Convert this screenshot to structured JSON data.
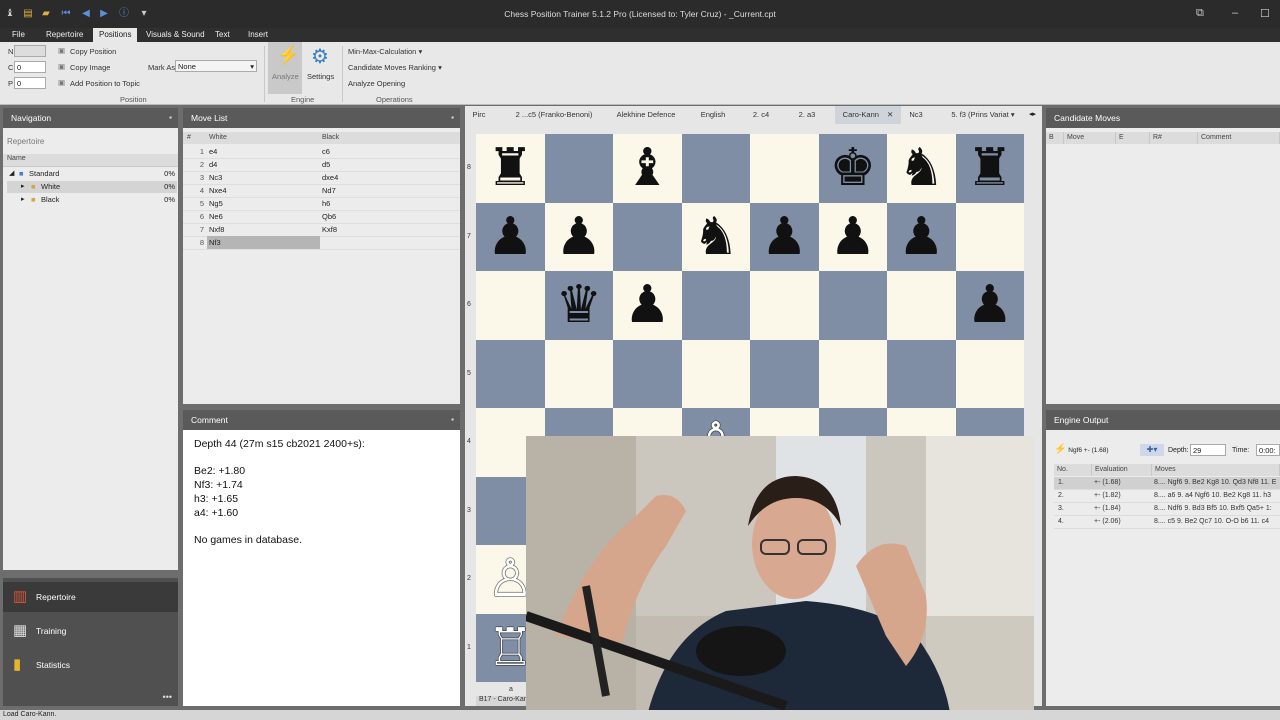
{
  "window": {
    "title": "Chess Position Trainer 5.1.2 Pro (Licensed to: Tyler Cruz) - _Current.cpt"
  },
  "ribbon_tabs": [
    {
      "label": "File",
      "active": false
    },
    {
      "label": "Repertoire",
      "active": false
    },
    {
      "label": "Positions",
      "active": true
    },
    {
      "label": "Visuals & Sound",
      "active": false
    },
    {
      "label": "Text",
      "active": false
    },
    {
      "label": "Insert",
      "active": false
    }
  ],
  "ribbon": {
    "n_label": "N",
    "c_label": "C",
    "p_label": "P",
    "c_value": "0",
    "p_value": "0",
    "copy_position": "Copy Position",
    "copy_image": "Copy Image",
    "add_position": "Add Position to Topic",
    "mark_as_label": "Mark As",
    "mark_as_value": "None",
    "position_group": "Position",
    "analyze": "Analyze",
    "settings": "Settings",
    "engine_group": "Engine",
    "min_max": "Min-Max-Calculation",
    "candidate_ranking": "Candidate Moves Ranking",
    "analyze_opening": "Analyze Opening",
    "operations_group": "Operations"
  },
  "navigation": {
    "title": "Navigation",
    "subtitle": "Repertoire",
    "col_name": "Name",
    "rows": [
      {
        "label": "Standard",
        "pct": "0%"
      },
      {
        "label": "White",
        "pct": "0%"
      },
      {
        "label": "Black",
        "pct": "0%"
      }
    ],
    "buttons": [
      {
        "label": "Repertoire"
      },
      {
        "label": "Training"
      },
      {
        "label": "Statistics"
      }
    ]
  },
  "movelist": {
    "title": "Move List",
    "headers": [
      "#",
      "White",
      "Black"
    ],
    "rows": [
      {
        "n": "1",
        "w": "e4",
        "b": "c6"
      },
      {
        "n": "2",
        "w": "d4",
        "b": "d5"
      },
      {
        "n": "3",
        "w": "Nc3",
        "b": "dxe4"
      },
      {
        "n": "4",
        "w": "Nxe4",
        "b": "Nd7"
      },
      {
        "n": "5",
        "w": "Ng5",
        "b": "h6"
      },
      {
        "n": "6",
        "w": "Ne6",
        "b": "Qb6"
      },
      {
        "n": "7",
        "w": "Nxf8",
        "b": "Kxf8"
      },
      {
        "n": "8",
        "w": "Nf3",
        "b": ""
      }
    ]
  },
  "comment": {
    "title": "Comment",
    "lines": [
      "Depth 44 (27m s15 cb2021 2400+s):",
      "Be2: +1.80",
      "Nf3: +1.74",
      "h3: +1.65",
      "a4: +1.60",
      "No games in database."
    ]
  },
  "board_tabs": [
    {
      "label": "Pirc"
    },
    {
      "label": "2 ...c5 (Franko-Benoni)"
    },
    {
      "label": "Alekhine Defence"
    },
    {
      "label": "English"
    },
    {
      "label": "2. c4"
    },
    {
      "label": "2. a3"
    },
    {
      "label": "Caro-Kann"
    },
    {
      "label": "Nc3"
    },
    {
      "label": "5. f3 (Prins Variat"
    }
  ],
  "board": {
    "ranks": [
      "8",
      "7",
      "6",
      "5",
      "4",
      "3",
      "2",
      "1"
    ],
    "file_label": "a",
    "pieces": [
      {
        "sq": "a8",
        "p": "♜",
        "c": "black"
      },
      {
        "sq": "c8",
        "p": "♝",
        "c": "black"
      },
      {
        "sq": "f8",
        "p": "♚",
        "c": "black"
      },
      {
        "sq": "g8",
        "p": "♞",
        "c": "black"
      },
      {
        "sq": "h8",
        "p": "♜",
        "c": "black"
      },
      {
        "sq": "a7",
        "p": "♟",
        "c": "black"
      },
      {
        "sq": "b7",
        "p": "♟",
        "c": "black"
      },
      {
        "sq": "d7",
        "p": "♞",
        "c": "black"
      },
      {
        "sq": "e7",
        "p": "♟",
        "c": "black"
      },
      {
        "sq": "f7",
        "p": "♟",
        "c": "black"
      },
      {
        "sq": "g7",
        "p": "♟",
        "c": "black"
      },
      {
        "sq": "b6",
        "p": "♛",
        "c": "black"
      },
      {
        "sq": "c6",
        "p": "♟",
        "c": "black"
      },
      {
        "sq": "h6",
        "p": "♟",
        "c": "black"
      },
      {
        "sq": "d4",
        "p": "♙",
        "c": "white"
      },
      {
        "sq": "a2",
        "p": "♙",
        "c": "white"
      },
      {
        "sq": "a1",
        "p": "♖",
        "c": "white"
      }
    ],
    "footer_tab": "B17 - Caro-Kann"
  },
  "candidate": {
    "title": "Candidate Moves",
    "headers": [
      "B",
      "Move",
      "E",
      "R#",
      "Comment"
    ]
  },
  "engine": {
    "title": "Engine Output",
    "toolbar_eval": "Ngf6 +- (1.68)",
    "depth_label": "Depth:",
    "depth_value": "29",
    "time_label": "Time:",
    "time_value": "0:00:",
    "headers": [
      "No.",
      "Evaluation",
      "Moves"
    ],
    "rows": [
      {
        "no": "1.",
        "eval": "+- (1.68)",
        "moves": "8.... Ngf6 9. Be2 Kg8 10. Qd3 Nf8 11. E"
      },
      {
        "no": "2.",
        "eval": "+- (1.82)",
        "moves": "8.... a6 9. a4 Ngf6 10. Be2 Kg8 11. h3"
      },
      {
        "no": "3.",
        "eval": "+- (1.84)",
        "moves": "8.... Ndf6 9. Bd3 Bf5 10. Bxf5 Qa5+ 1:"
      },
      {
        "no": "4.",
        "eval": "+- (2.06)",
        "moves": "8.... c5 9. Be2 Qc7 10. O-O b6 11. c4"
      }
    ]
  },
  "status": {
    "text": "Load Caro-Kann."
  }
}
